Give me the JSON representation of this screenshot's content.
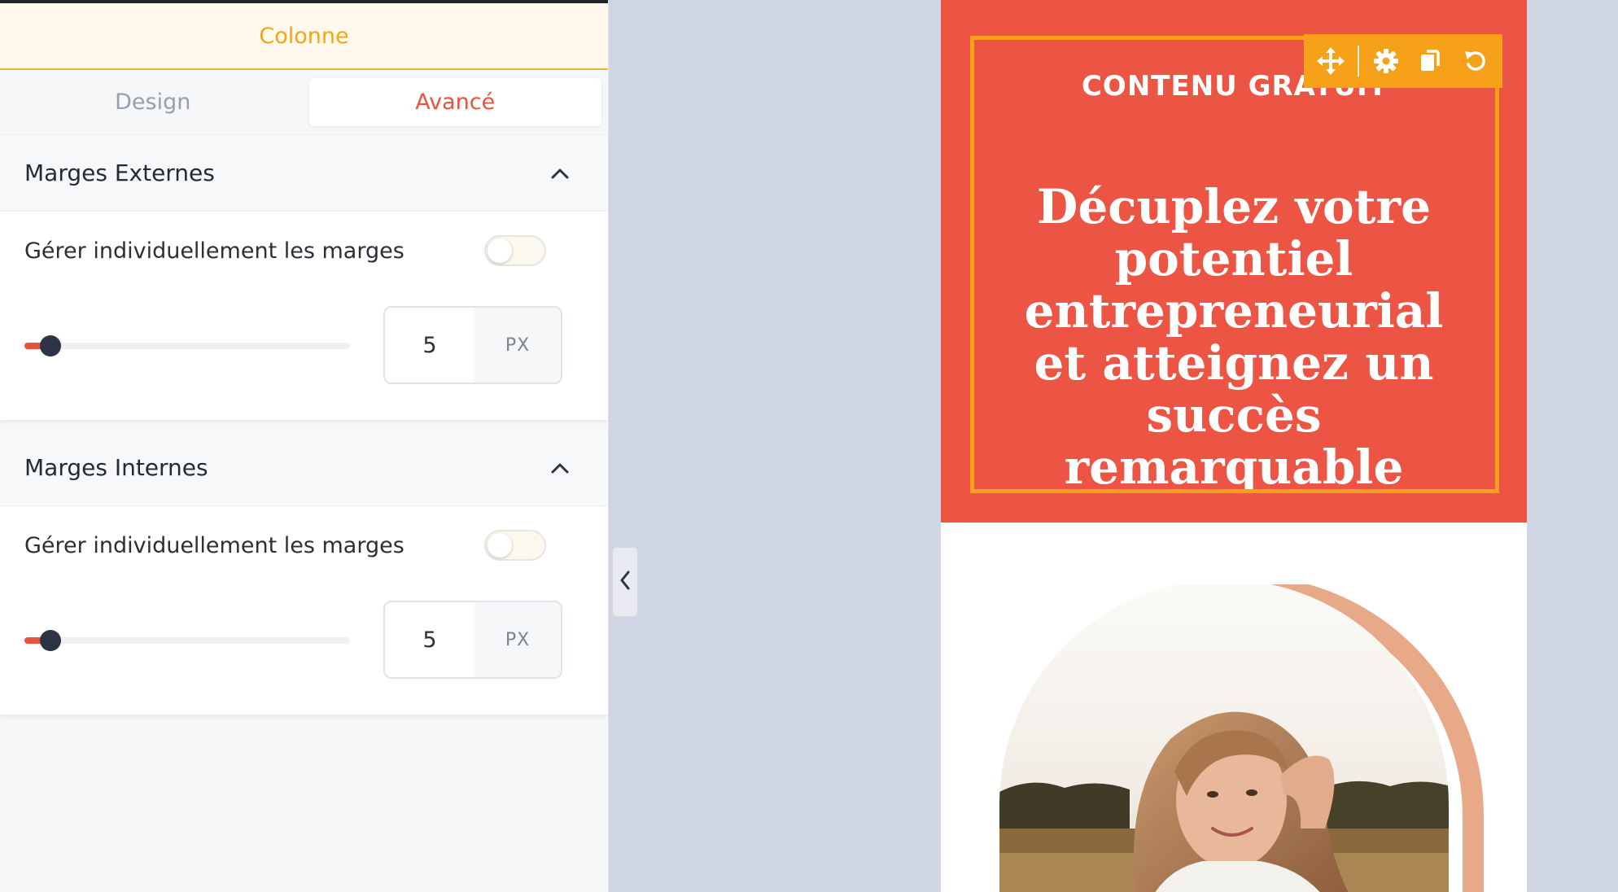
{
  "panel": {
    "title": "Colonne",
    "tabs": [
      {
        "label": "Design",
        "active": false
      },
      {
        "label": "Avancé",
        "active": true
      }
    ],
    "sections": [
      {
        "title": "Marges Externes",
        "expanded": true,
        "toggle_label": "Gérer individuellement les marges",
        "toggle_on": false,
        "slider_fraction": 0.08,
        "value": "5",
        "unit": "PX"
      },
      {
        "title": "Marges Internes",
        "expanded": true,
        "toggle_label": "Gérer individuellement les marges",
        "toggle_on": false,
        "slider_fraction": 0.08,
        "value": "5",
        "unit": "PX"
      }
    ]
  },
  "preview": {
    "eyebrow": "CONTENU GRATUIT",
    "headline": "Décuplez votre potentiel entrepreneurial et atteignez un succès remarquable",
    "toolbar_icons": [
      "move-icon",
      "gear-icon",
      "duplicate-icon",
      "reset-icon"
    ]
  },
  "colors": {
    "accent_orange": "#f7a11a",
    "brand_red": "#ec5443",
    "active_tab": "#e9533e",
    "canvas_bg": "#cfd5e2"
  }
}
